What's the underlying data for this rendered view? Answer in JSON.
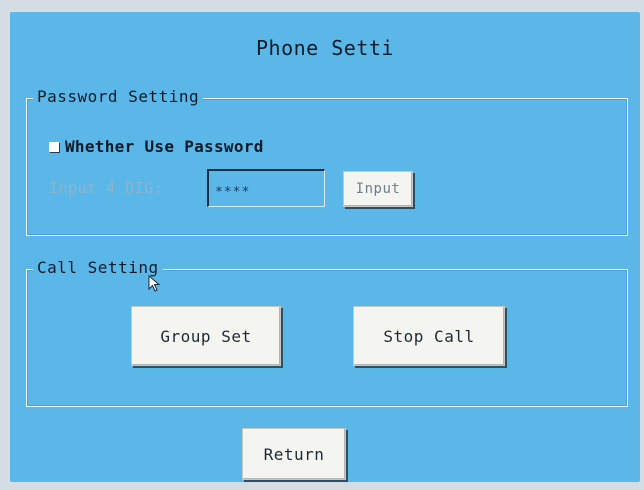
{
  "screen": {
    "title": "Phone Setti"
  },
  "password_setting": {
    "legend": "Password Setting",
    "checkbox_label": "Whether Use Password",
    "checkbox_checked": false,
    "pin_label": "Input 4 DIG:",
    "pin_value": "****",
    "input_button_label": "Input"
  },
  "call_setting": {
    "legend": "Call Setting",
    "group_set_label": "Group Set",
    "stop_call_label": "Stop Call"
  },
  "footer": {
    "return_label": "Return"
  },
  "colors": {
    "background": "#5ab7e7",
    "button_face": "#f4f4f1",
    "text": "#0b1b2a",
    "disabled_text": "#8fb3cc"
  },
  "icons": {
    "cursor": "mouse-pointer-icon"
  }
}
